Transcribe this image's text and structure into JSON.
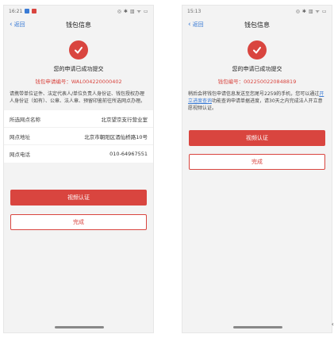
{
  "left": {
    "status": {
      "time": "16:21",
      "icons": "◎ ✱ ▥ ᯤ ▭"
    },
    "nav": {
      "back_label": "返回",
      "title": "钱包信息"
    },
    "success_text": "您的申请已成功提交",
    "application_no": "钱包申请编号：WAL004220000402",
    "notice": "请携带单位证件、法定代表人/单位负责人身份证、钱包授权办理人身份证（如有）、公章、法人章、预留印鉴前往所选网点办理。",
    "info": [
      {
        "label": "所选网点名称",
        "value": "北京望京支行营业室"
      },
      {
        "label": "网点地址",
        "value": "北京市朝阳区酒仙桥路10号"
      },
      {
        "label": "网点电话",
        "value": "010-64967551"
      }
    ],
    "video_button": "视频认证",
    "done_button": "完成"
  },
  "right": {
    "status": {
      "time": "15:13",
      "icons": "◎ ✱ ▥ ᯤ ▭"
    },
    "nav": {
      "back_label": "返回",
      "title": "钱包信息"
    },
    "success_text": "您的申请已成功提交",
    "wallet_no": "钱包编号：0022500220848819",
    "notice_before": "稍后会将钱包申请信息发送至您尾号2259的手机，您可以通过",
    "notice_link": "开立进度查询",
    "notice_after": "功能查询申请单据进度，请30天之内完成法人开立意愿视频认证。",
    "video_button": "视频认证",
    "done_button": "完成"
  },
  "edge_glyph": "‹",
  "colors": {
    "accent": "#d9453f",
    "link": "#3a7bd5",
    "background": "#f3f3f3"
  }
}
